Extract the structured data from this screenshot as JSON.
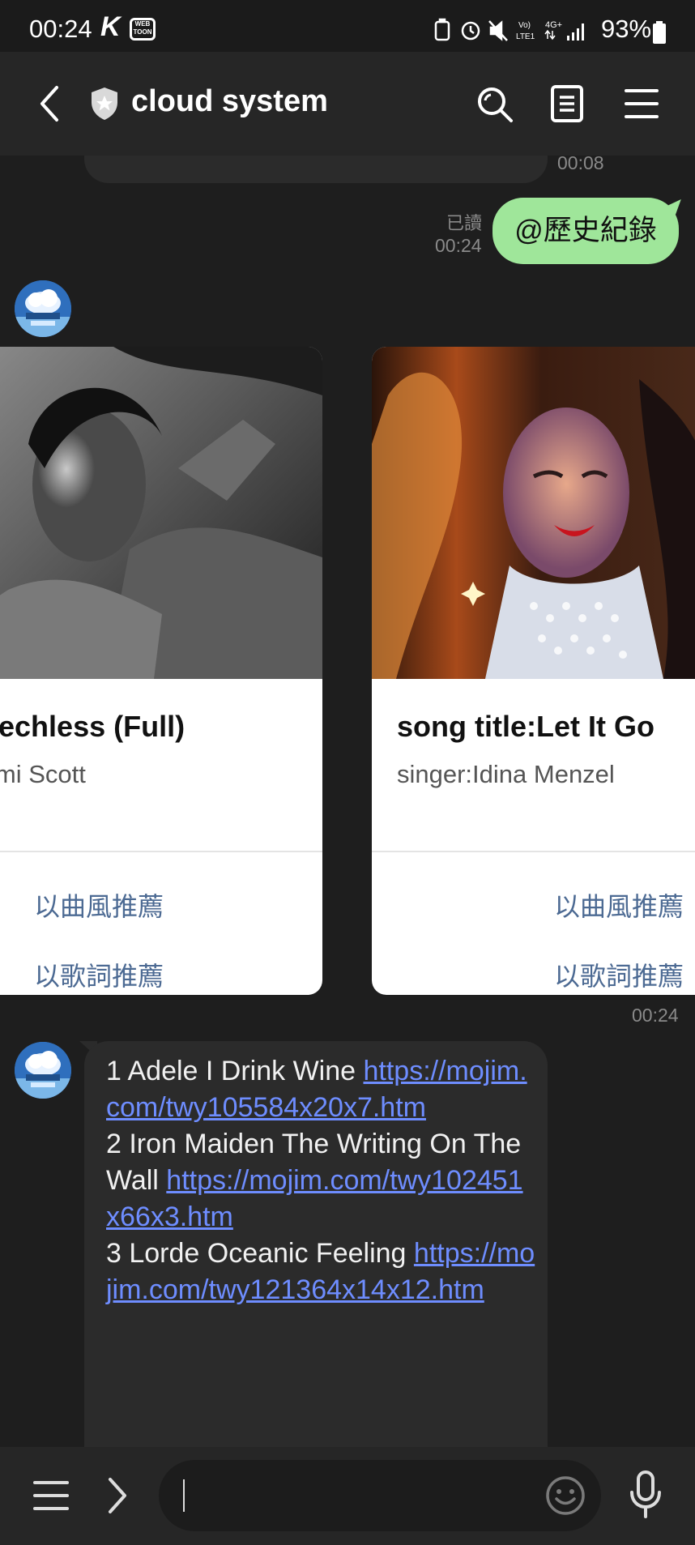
{
  "status_bar": {
    "time": "00:24",
    "app_k": "K",
    "app_webtoon": "WEB TOON",
    "battery": "93%"
  },
  "header": {
    "title": "cloud system"
  },
  "chat": {
    "prev_time": "00:08",
    "my_message": {
      "text": "@歷史紀錄",
      "read": "已讀",
      "time": "00:24"
    },
    "cards": [
      {
        "title": "song title:Speechless (Full)",
        "singer": "singer:Naomi Scott",
        "actions": [
          "以曲風推薦",
          "以歌詞推薦"
        ]
      },
      {
        "title": "song title:Let It Go",
        "singer": "singer:Idina Menzel",
        "actions": [
          "以曲風推薦",
          "以歌詞推薦"
        ]
      }
    ],
    "cards_time": "00:24",
    "bot_message": {
      "items": [
        {
          "text": "1 Adele I Drink Wine ",
          "link": "https://mojim.com/twy105584x20x7.htm"
        },
        {
          "text": "2 Iron Maiden The Writing On The Wall ",
          "link": "https://mojim.com/twy102451x66x3.htm"
        },
        {
          "text": "3 Lorde Oceanic Feeling ",
          "link": "https://mojim.com/twy121364x14x12.htm"
        }
      ]
    }
  },
  "colors": {
    "my_bubble": "#9fe69a",
    "link": "#6e8dff",
    "card_action": "#4c6a93",
    "background": "#1e1e1e"
  }
}
